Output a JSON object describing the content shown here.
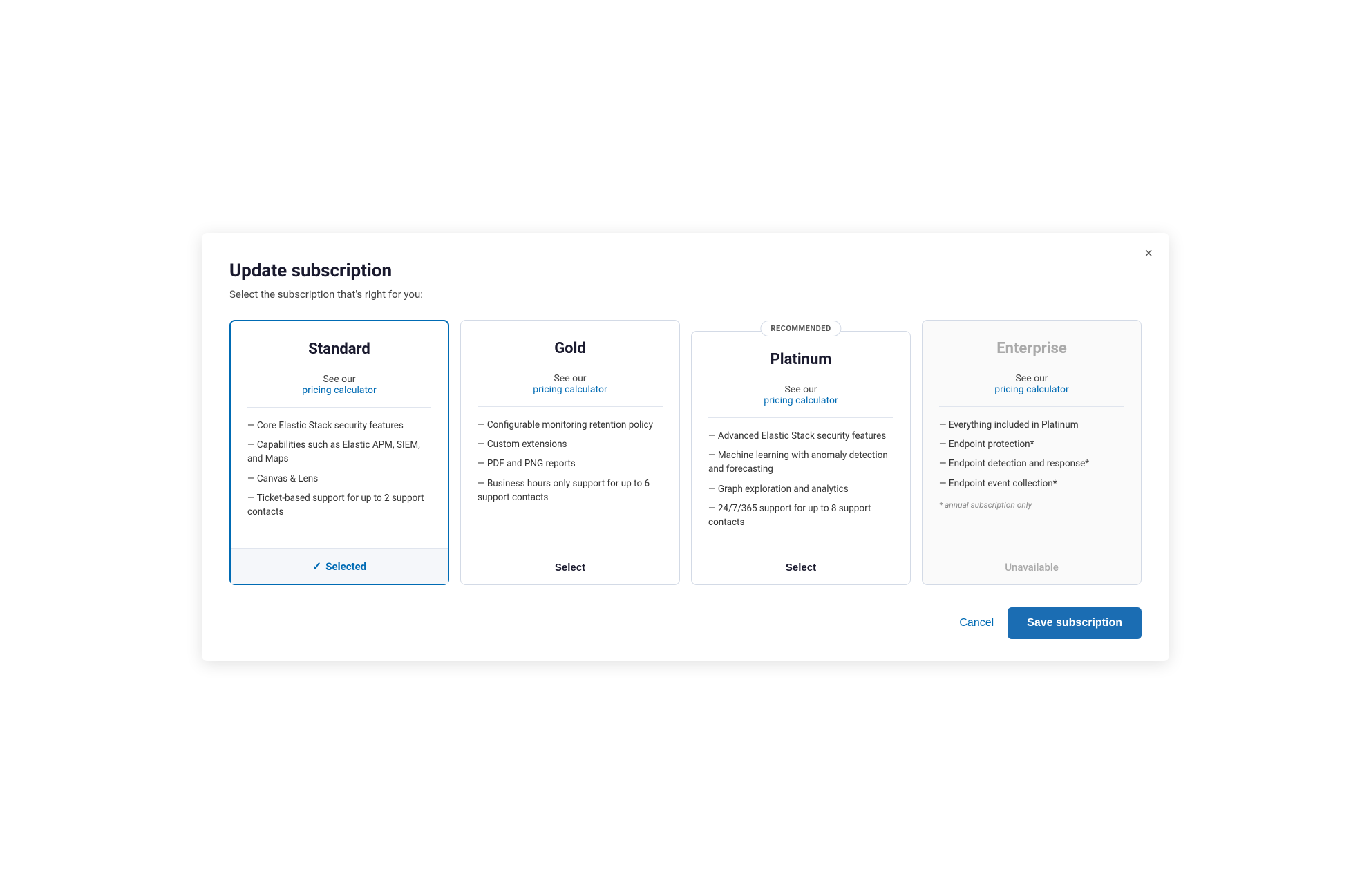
{
  "modal": {
    "title": "Update subscription",
    "subtitle": "Select the subscription that's right for you:",
    "close_label": "×"
  },
  "plans": [
    {
      "id": "standard",
      "name": "Standard",
      "pricing_see": "See our",
      "pricing_link": "pricing calculator",
      "features": [
        "Core Elastic Stack security features",
        "Capabilities such as Elastic APM, SIEM, and Maps",
        "Canvas & Lens",
        "Ticket-based support for up to 2 support contacts"
      ],
      "annual_note": null,
      "state": "selected",
      "recommended": false,
      "cta_label": "Selected",
      "disabled": false
    },
    {
      "id": "gold",
      "name": "Gold",
      "pricing_see": "See our",
      "pricing_link": "pricing calculator",
      "features": [
        "Configurable monitoring retention policy",
        "Custom extensions",
        "PDF and PNG reports",
        "Business hours only support for up to 6 support contacts"
      ],
      "annual_note": null,
      "state": "selectable",
      "recommended": false,
      "cta_label": "Select",
      "disabled": false
    },
    {
      "id": "platinum",
      "name": "Platinum",
      "pricing_see": "See our",
      "pricing_link": "pricing calculator",
      "features": [
        "Advanced Elastic Stack security features",
        "Machine learning with anomaly detection and forecasting",
        "Graph exploration and analytics",
        "24/7/365 support for up to 8 support contacts"
      ],
      "annual_note": null,
      "state": "selectable",
      "recommended": true,
      "recommended_label": "RECOMMENDED",
      "cta_label": "Select",
      "disabled": false
    },
    {
      "id": "enterprise",
      "name": "Enterprise",
      "pricing_see": "See our",
      "pricing_link": "pricing calculator",
      "features": [
        "Everything included in Platinum",
        "Endpoint protection*",
        "Endpoint detection and response*",
        "Endpoint event collection*"
      ],
      "annual_note": "* annual subscription only",
      "state": "unavailable",
      "recommended": false,
      "cta_label": "Unavailable",
      "disabled": true
    }
  ],
  "actions": {
    "cancel_label": "Cancel",
    "save_label": "Save subscription"
  }
}
